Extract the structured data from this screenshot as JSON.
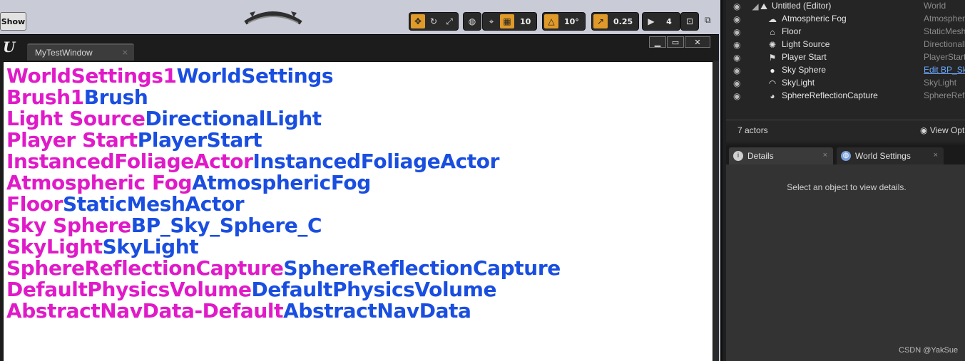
{
  "viewport": {
    "show_label": "Show",
    "toolbar": {
      "grid_snap_value": "10",
      "rotation_snap_value": "10°",
      "scale_snap_value": "0.25",
      "camera_speed_value": "4"
    }
  },
  "window": {
    "tab_title": "MyTestWindow",
    "tab_close": "×",
    "controls": {
      "minimize": "▁",
      "maximize": "▭",
      "close": "✕"
    },
    "rows": [
      {
        "label": "WorldSettings1",
        "class": "WorldSettings"
      },
      {
        "label": "Brush1",
        "class": "Brush"
      },
      {
        "label": "Light Source",
        "class": "DirectionalLight"
      },
      {
        "label": "Player Start",
        "class": "PlayerStart"
      },
      {
        "label": "InstancedFoliageActor",
        "class": "InstancedFoliageActor"
      },
      {
        "label": "Atmospheric Fog",
        "class": "AtmosphericFog"
      },
      {
        "label": "Floor",
        "class": "StaticMeshActor"
      },
      {
        "label": "Sky Sphere",
        "class": "BP_Sky_Sphere_C"
      },
      {
        "label": "SkyLight",
        "class": "SkyLight"
      },
      {
        "label": "SphereReflectionCapture",
        "class": "SphereReflectionCapture"
      },
      {
        "label": "DefaultPhysicsVolume",
        "class": "DefaultPhysicsVolume"
      },
      {
        "label": "AbstractNavData-Default",
        "class": "AbstractNavData"
      }
    ]
  },
  "outliner": {
    "items": [
      {
        "name": "Untitled (Editor)",
        "type": "World",
        "icon": "world-icon"
      },
      {
        "name": "Atmospheric Fog",
        "type": "AtmosphericFog",
        "icon": "fog-icon"
      },
      {
        "name": "Floor",
        "type": "StaticMeshActor",
        "icon": "mesh-icon"
      },
      {
        "name": "Light Source",
        "type": "DirectionalLight",
        "icon": "sun-icon"
      },
      {
        "name": "Player Start",
        "type": "PlayerStart",
        "icon": "player-icon"
      },
      {
        "name": "Sky Sphere",
        "type": "Edit BP_Sky_Sphere",
        "icon": "sphere-icon"
      },
      {
        "name": "SkyLight",
        "type": "SkyLight",
        "icon": "skylight-icon"
      },
      {
        "name": "SphereReflectionCapture",
        "type": "SphereReflectionCapture",
        "icon": "capture-icon"
      }
    ],
    "actor_count": "7 actors",
    "view_options": "View Options"
  },
  "details": {
    "tabs": [
      {
        "label": "Details",
        "close": "×"
      },
      {
        "label": "World Settings",
        "close": "×"
      }
    ],
    "empty_message": "Select an object to view details."
  },
  "watermark": "CSDN @YakSue",
  "colors": {
    "label_magenta": "#e01ac8",
    "class_blue": "#1a4ee0",
    "active_orange": "#e09a2a"
  }
}
